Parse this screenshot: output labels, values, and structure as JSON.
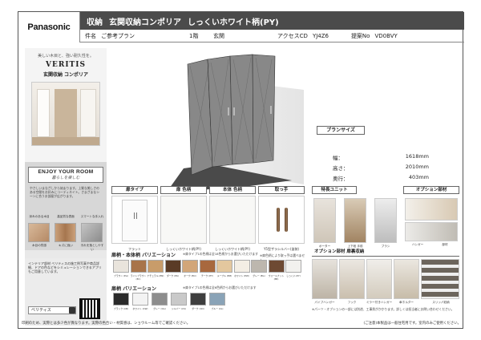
{
  "header": {
    "logo": "Panasonic",
    "title_part1": "収納",
    "title_part2": "玄関収納コンポリア",
    "title_part3": "しっくいホワイト柄(PY)",
    "sub_name_label": "件名",
    "sub_name": "ご参考プラン",
    "sub_floor": "1階",
    "sub_room": "玄関",
    "sub_access": "アクセスCD",
    "sub_access_value": "YJ4Z6",
    "sub_proposal": "提案No",
    "sub_proposal_value": "VD0BVY"
  },
  "left": {
    "tagline": "美しい木目と、強い耐久性を。",
    "brand": "VERITIS",
    "category": "玄関収納 コンポリア",
    "enjoy_title": "ENJOY YOUR ROOM",
    "enjoy_sub": "暮らしを楽しむ",
    "enjoy_text": "やさしいまなざしから始まります。上質な美しさのある空間をお好みにコーディネイト。さまざまなシーンに合うお部屋が広がります。",
    "tile_labels": [
      "深みのある木目",
      "高品質な表面",
      "スマートな手入れ"
    ],
    "tile_captions": [
      "木目の質感",
      "キズに強い",
      "汚れを落としやすい"
    ],
    "bottom_text": "インテリア部材 ベリティスの施工例写真や商品詳細、ドアの色などをシミュレーションできるアプリもご用意しています。",
    "search_text": "ベリティス"
  },
  "size": {
    "title": "プランサイズ",
    "rows": [
      {
        "k": "幅：",
        "v": "1618mm"
      },
      {
        "k": "高さ：",
        "v": "2010mm"
      },
      {
        "k": "奥行：",
        "v": "403mm"
      }
    ]
  },
  "parts": {
    "headers": [
      "扉タイプ",
      "扉 色柄",
      "本体 色柄",
      "取っ手"
    ],
    "captions": [
      "フラット",
      "しっくいホワイト柄(PY)",
      "しっくいホワイト柄(PY)",
      "Y5型ザラシルバー(塗装)"
    ],
    "handle_note": "※扉色柄により取っ手は選べません",
    "door_section": "扉柄・本体柄 バリエーション",
    "door_note": "※扉タイプ1の色柄は全18色柄からお選びいただけます",
    "door_swatches": [
      {
        "name": "ブラウン",
        "code": "(EA)",
        "color": "#e9e4dc"
      },
      {
        "name": "ライトブラウン",
        "code": "(EC)",
        "color": "#a8744a"
      },
      {
        "name": "ナチュラル",
        "code": "(EN)",
        "color": "#c89c6a"
      },
      {
        "name": "ダーク",
        "code": "(EK)",
        "color": "#5a3b26"
      },
      {
        "name": "オーク",
        "code": "(EO)",
        "color": "#d2a679"
      },
      {
        "name": "チーク",
        "code": "(ET)",
        "color": "#a8683e"
      },
      {
        "name": "メープル",
        "code": "(EM)",
        "color": "#e3c79e"
      },
      {
        "name": "ホワイト",
        "code": "(EW)",
        "color": "#f4eee4"
      },
      {
        "name": "グレー",
        "code": "(EG)",
        "color": "#bdb7ae"
      },
      {
        "name": "ウォールナット",
        "code": "(EB)",
        "color": "#6e4a33"
      },
      {
        "name": "しっくい",
        "code": "(PY)",
        "color": "#f2f1ee"
      }
    ],
    "frame_section": "扉柄 バリエーション",
    "frame_note": "※扉タイプ1の色柄は全6色柄からお選びいただけます",
    "frame_swatches": [
      {
        "name": "ブラック",
        "code": "(CB)",
        "color": "#2a2a2a"
      },
      {
        "name": "ホワイト",
        "code": "(CW)",
        "color": "#f3f3f3"
      },
      {
        "name": "グレー",
        "code": "(CG)",
        "color": "#8d8d8d"
      },
      {
        "name": "シルバー",
        "code": "(CS)",
        "color": "#c9c9c9"
      },
      {
        "name": "ダーク",
        "code": "(CD)",
        "color": "#3e3e3e"
      },
      {
        "name": "ブルー",
        "code": "(CL)",
        "color": "#8aa3b7"
      }
    ]
  },
  "special": {
    "title": "特長ユニット",
    "captions": [
      "ポーター",
      "上下段 手前",
      "ブラシ"
    ],
    "option_title": "オプション部材",
    "option_captions": [
      "ハンガー",
      "部材"
    ],
    "storage_title": "オプション部材 扉裏収納",
    "storage_captions": [
      "パイプハンガー",
      "フック",
      "ミラー付きハンガー",
      "傘ホルダー",
      "スリッパ収納"
    ],
    "storage_note": "※パーツ・オプションの一部には別途、工事費がかかります。詳しくは担当者にお問い合わせください。"
  },
  "footer": {
    "left": "印刷のため、実際とは多少色が異なります。実際の色合い・材質感は、ショウルーム等でご確認ください。",
    "right": "(ご注意)本製品は一般住宅用です。室内のみご使用ください。"
  }
}
